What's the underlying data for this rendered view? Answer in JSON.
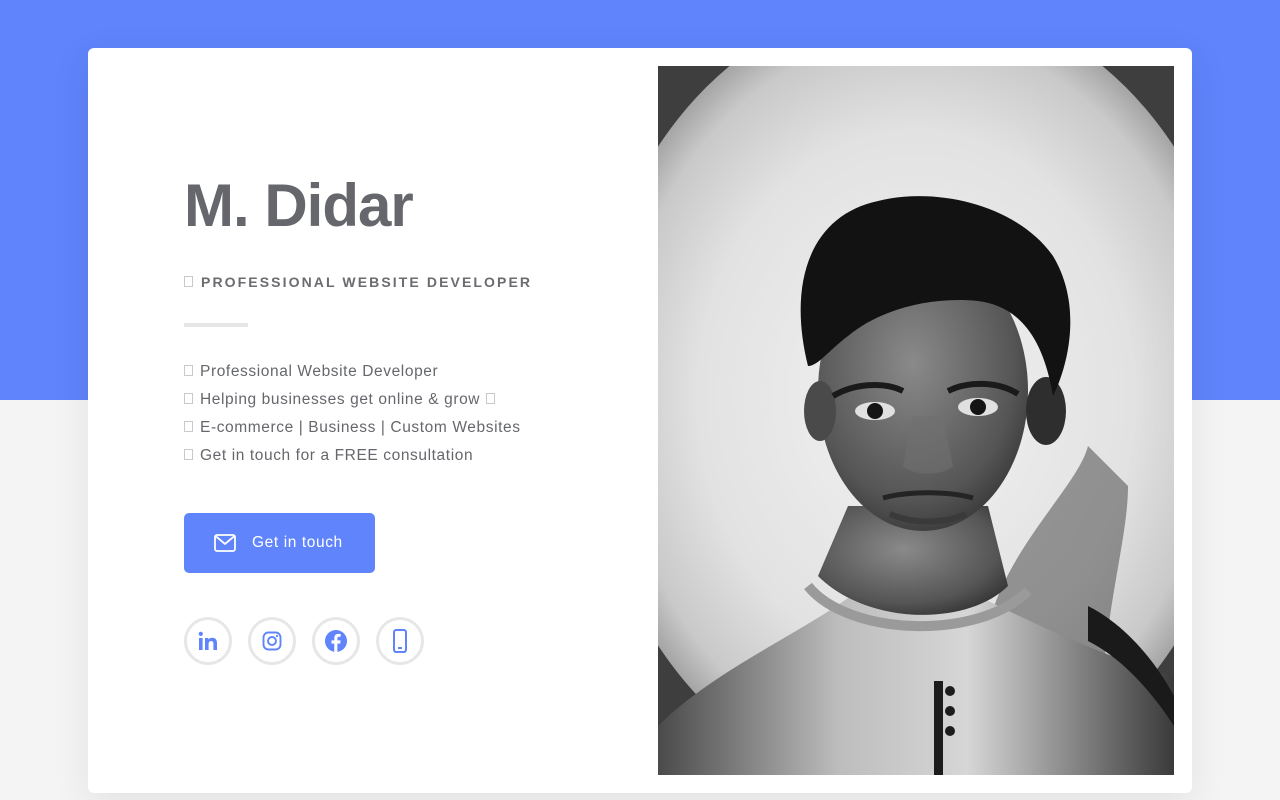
{
  "profile": {
    "name": "M. Didar",
    "title": "PROFESSIONAL WEBSITE DEVELOPER"
  },
  "bio": {
    "items": [
      "Professional Website Developer",
      "Helping businesses get online & grow",
      "E-commerce | Business | Custom Websites",
      "Get in touch for a FREE consultation"
    ]
  },
  "cta": {
    "label": "Get in touch",
    "icon": "envelope-icon"
  },
  "socials": [
    {
      "icon": "linkedin-icon"
    },
    {
      "icon": "instagram-icon"
    },
    {
      "icon": "facebook-icon"
    },
    {
      "icon": "phone-icon"
    }
  ],
  "colors": {
    "accent": "#5f84fb",
    "page_background": "#f4f4f4",
    "card": "#ffffff",
    "heading": "#66676c"
  }
}
